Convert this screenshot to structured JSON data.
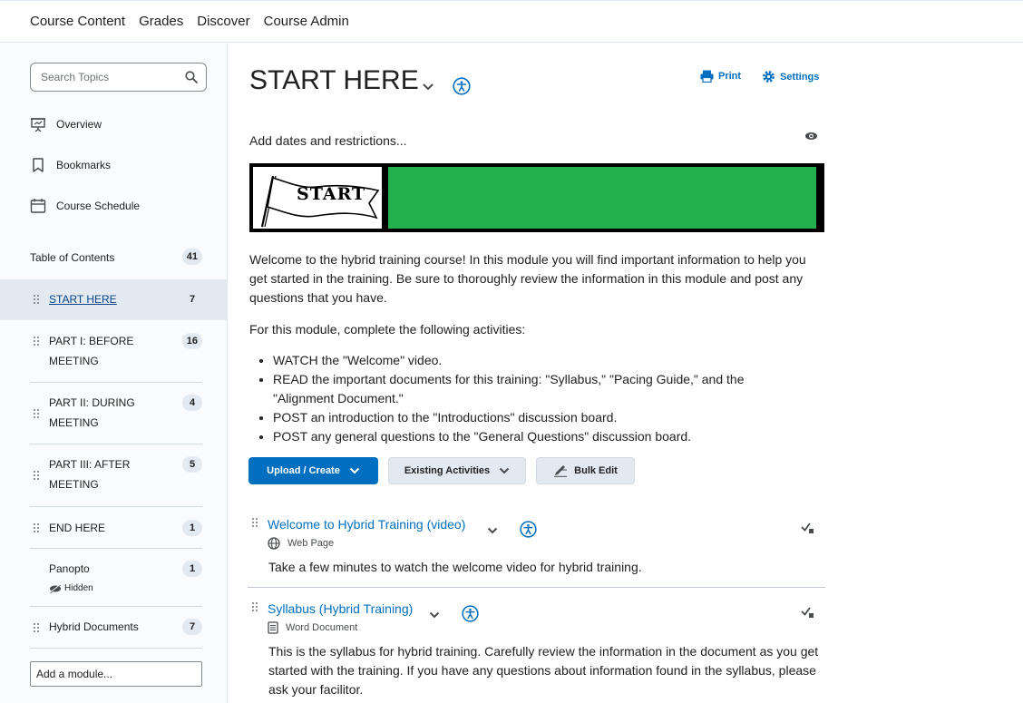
{
  "topnav": {
    "items": [
      "Course Content",
      "Grades",
      "Discover",
      "Course Admin"
    ]
  },
  "sidebar": {
    "search_placeholder": "Search Topics",
    "nav": {
      "overview": "Overview",
      "bookmarks": "Bookmarks",
      "schedule": "Course Schedule"
    },
    "toc_label": "Table of Contents",
    "toc_count": "41",
    "modules": [
      {
        "label": "START HERE",
        "count": "7"
      },
      {
        "label": "PART I: BEFORE MEETING",
        "count": "16"
      },
      {
        "label": "PART II: DURING MEETING",
        "count": "4"
      },
      {
        "label": "PART III: AFTER MEETING",
        "count": "5"
      },
      {
        "label": "END HERE",
        "count": "1"
      },
      {
        "label": "Panopto",
        "count": "1",
        "status": "Hidden"
      },
      {
        "label": "Hybrid Documents",
        "count": "7"
      }
    ],
    "add_module_placeholder": "Add a module..."
  },
  "main": {
    "title": "START HERE",
    "print_label": "Print",
    "settings_label": "Settings",
    "add_dates_label": "Add dates and restrictions...",
    "banner_text": "START",
    "intro": "Welcome to the hybrid training course! In this module you will find important information to help you get started in the training.  Be sure to thoroughly review the information in this module and post any questions that you have.",
    "activities_heading": "For this module, complete the following activities:",
    "activities": [
      "WATCH the \"Welcome\" video.",
      "READ the important documents for this training: \"Syllabus,\" \"Pacing Guide,\" and the \"Alignment Document.\"",
      "POST an introduction to the \"Introductions\" discussion board.",
      "POST any general questions to the \"General Questions\" discussion board."
    ],
    "buttons": {
      "upload": "Upload / Create",
      "existing": "Existing Activities",
      "bulk": "Bulk Edit"
    },
    "topics": [
      {
        "title": "Welcome to Hybrid Training (video)",
        "type": "Web Page",
        "description": "Take a few minutes to watch the welcome video for hybrid training."
      },
      {
        "title": "Syllabus (Hybrid Training)",
        "type": "Word Document",
        "description": "This is the syllabus for hybrid training.  Carefully review the information in the document as you get started with the training.  If you have any questions about information found in the syllabus, please ask your facilitor."
      }
    ]
  },
  "colors": {
    "accent": "#006fbf",
    "banner_green": "#23b14d",
    "sidebar_bg": "#f9fbff"
  }
}
